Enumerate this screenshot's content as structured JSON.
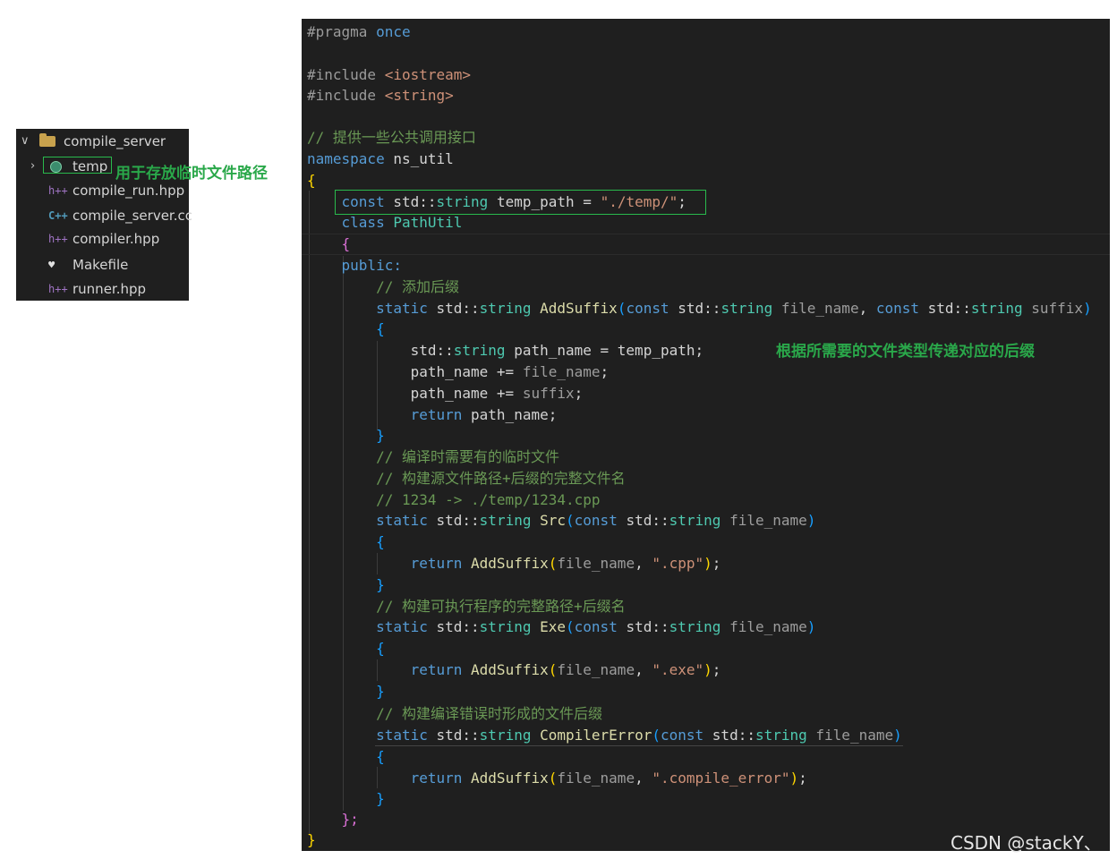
{
  "explorer": {
    "root_folder": "compile_server",
    "items": [
      {
        "label": "temp",
        "icon": "clock-folder-icon"
      },
      {
        "label": "compile_run.hpp",
        "icon_text": "h++",
        "icon": "cpp-header-icon"
      },
      {
        "label": "compile_server.cc",
        "icon_text": "C++",
        "icon": "cpp-source-icon"
      },
      {
        "label": "compiler.hpp",
        "icon_text": "h++",
        "icon": "cpp-header-icon"
      },
      {
        "label": "Makefile",
        "icon_text": "♥",
        "icon": "makefile-icon"
      },
      {
        "label": "runner.hpp",
        "icon_text": "h++",
        "icon": "cpp-header-icon"
      }
    ]
  },
  "annotations": {
    "temp_note": "用于存放临时文件路径",
    "suffix_note": "根据所需要的文件类型传递对应的后缀"
  },
  "code": {
    "l1_pragma": "#pragma",
    "l1_once": "once",
    "l3_include": "#include",
    "l3_header": "<iostream>",
    "l4_include": "#include",
    "l4_header": "<string>",
    "l6_comment": "// 提供一些公共调用接口",
    "l7_namespace": "namespace",
    "l7_name": "ns_util",
    "brace_open": "{",
    "brace_close": "}",
    "l9_const": "const",
    "l9_std": "std::",
    "l9_string": "string",
    "l9_var": "temp_path",
    "l9_eq": " = ",
    "l9_value": "\"./temp/\"",
    "l9_semi": ";",
    "l10_class": "class",
    "l10_name": "PathUtil",
    "l11_brace": "{",
    "l12_public": "public:",
    "l13_comment": "// 添加后缀",
    "static": "static",
    "std": "std::",
    "string": "string",
    "const": "const",
    "fn_addsuffix": "AddSuffix",
    "p_file_name": "file_name",
    "p_suffix": "suffix",
    "l17_type": "std::",
    "l17_string": "string",
    "l17_rest": " path_name = temp_path;",
    "l18_a": "path_name += ",
    "l18_b": "file_name",
    "l18_c": ";",
    "l19_a": "path_name += ",
    "l19_b": "suffix",
    "l19_c": ";",
    "return": "return",
    "l20_rest": " path_name;",
    "l22_comment": "// 编译时需要有的临时文件",
    "l23_comment": "// 构建源文件路径+后缀的完整文件名",
    "l24_comment": "// 1234 -> ./temp/1234.cpp",
    "fn_src": "Src",
    "fn_addsuffix_call": "AddSuffix",
    "s_cpp": "\".cpp\"",
    "l29_comment": "// 构建可执行程序的完整路径+后缀名",
    "fn_exe": "Exe",
    "s_exe": "\".exe\"",
    "l34_comment": "// 构建编译错误时形成的文件后缀",
    "fn_compile_error": "CompilerError",
    "s_compile_error": "\".compile_error\"",
    "class_end": "};",
    "ns_end": "}"
  },
  "watermark": "CSDN @stackY、"
}
